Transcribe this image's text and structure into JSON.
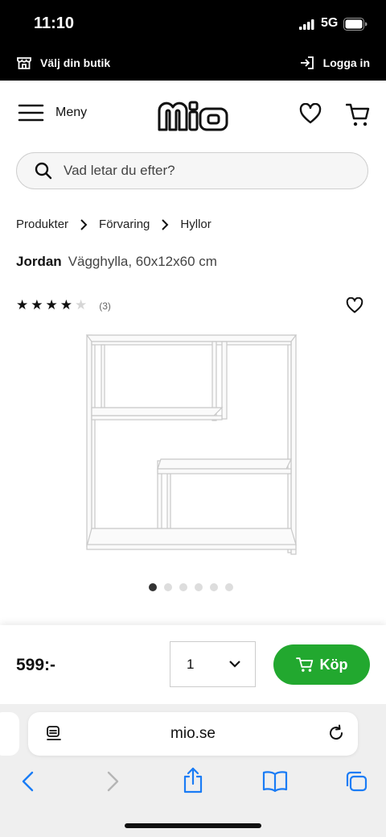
{
  "status": {
    "time": "11:10",
    "network": "5G"
  },
  "topbar": {
    "store_label": "Välj din butik",
    "login_label": "Logga in"
  },
  "header": {
    "menu_label": "Meny",
    "logo_text": "mio"
  },
  "search": {
    "placeholder": "Vad letar du efter?"
  },
  "breadcrumb": [
    "Produkter",
    "Förvaring",
    "Hyllor"
  ],
  "product": {
    "brand": "Jordan",
    "description": "Vägghylla, 60x12x60 cm",
    "rating": 4,
    "rating_max": 5,
    "review_count": "(3)",
    "image_count": 6,
    "active_image": 1,
    "price": "599:-",
    "quantity": "1",
    "buy_label": "Köp"
  },
  "browser": {
    "url": "mio.se"
  },
  "colors": {
    "buy_green": "#22a82f",
    "status_bg": "#000000"
  }
}
